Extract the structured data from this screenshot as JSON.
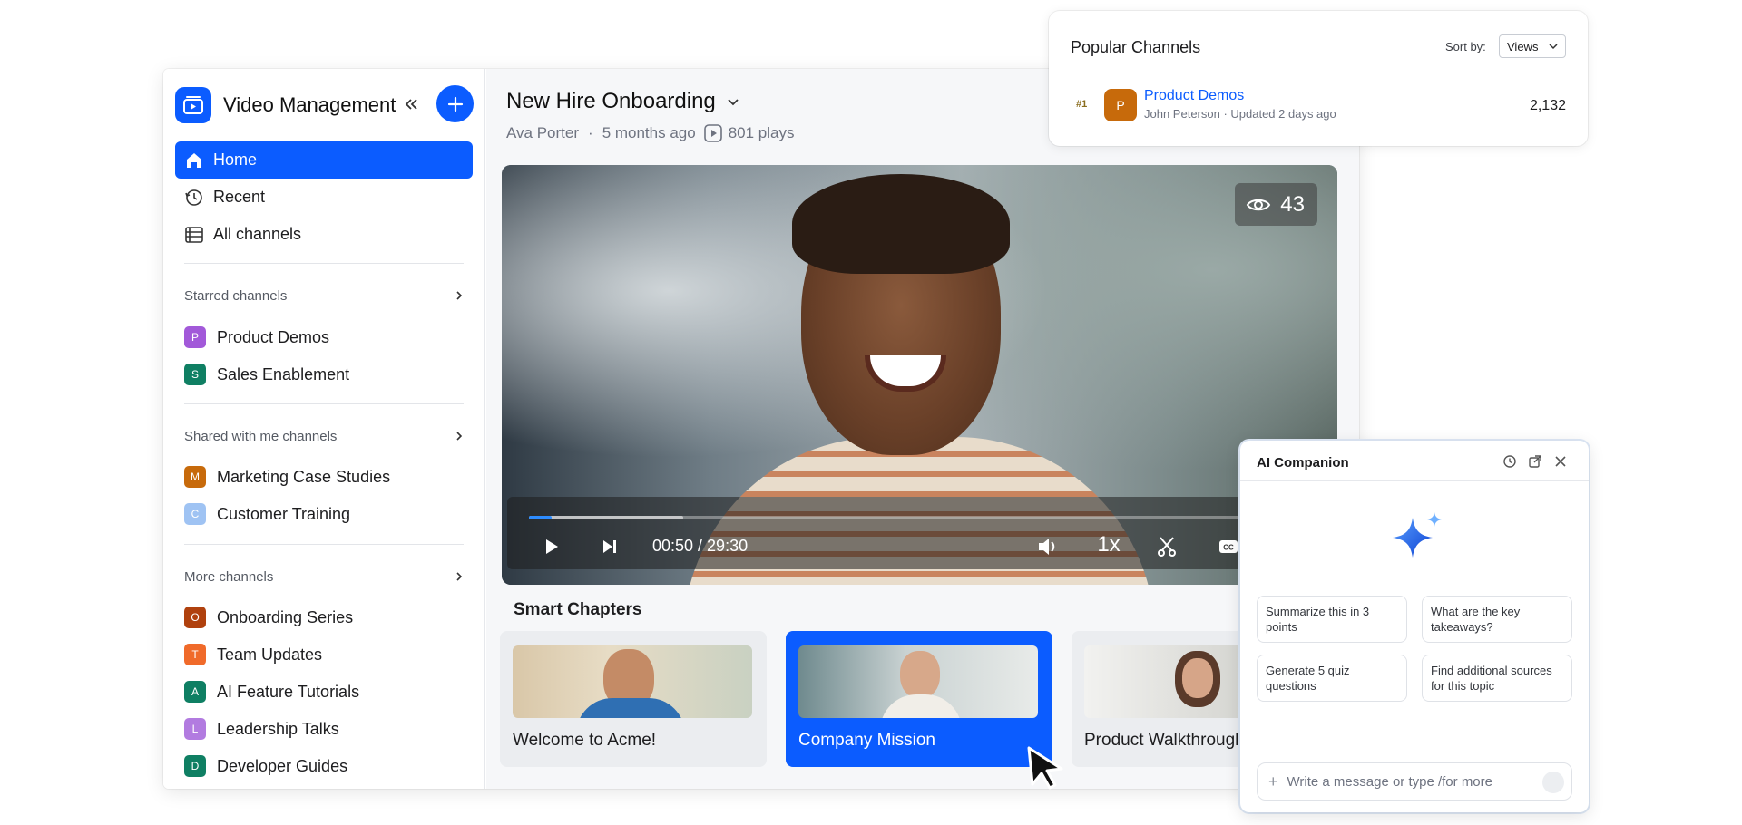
{
  "sidebar": {
    "app_title": "Video Management",
    "nav": [
      {
        "label": "Home",
        "icon": "home-icon",
        "active": true
      },
      {
        "label": "Recent",
        "icon": "history-icon",
        "active": false
      },
      {
        "label": "All channels",
        "icon": "channels-list-icon",
        "active": false
      }
    ],
    "sections": [
      {
        "title": "Starred channels",
        "channels": [
          {
            "letter": "P",
            "name": "Product Demos",
            "color": "#a259d9"
          },
          {
            "letter": "S",
            "name": "Sales Enablement",
            "color": "#0f7f63"
          }
        ]
      },
      {
        "title": "Shared with me channels",
        "channels": [
          {
            "letter": "M",
            "name": "Marketing Case Studies",
            "color": "#c76a0b"
          },
          {
            "letter": "C",
            "name": "Customer Training",
            "color": "#9fc3f3"
          }
        ]
      },
      {
        "title": "More channels",
        "channels": [
          {
            "letter": "O",
            "name": "Onboarding Series",
            "color": "#b0410e"
          },
          {
            "letter": "T",
            "name": "Team Updates",
            "color": "#f06a2a"
          },
          {
            "letter": "A",
            "name": "AI Feature Tutorials",
            "color": "#0f7f63"
          },
          {
            "letter": "L",
            "name": "Leadership Talks",
            "color": "#b27be0"
          },
          {
            "letter": "D",
            "name": "Developer Guides",
            "color": "#0f7f63"
          }
        ]
      }
    ]
  },
  "video": {
    "title": "New Hire Onboarding",
    "author": "Ava Porter",
    "age": "5 months ago",
    "plays": "801 plays",
    "views": "43",
    "time": "00:50 / 29:30",
    "speed": "1x",
    "progress": 0.028
  },
  "chapters": {
    "title": "Smart Chapters",
    "items": [
      {
        "label": "Welcome to Acme!",
        "active": false
      },
      {
        "label": "Company Mission",
        "active": true
      },
      {
        "label": "Product Walkthrough",
        "active": false
      }
    ]
  },
  "popular": {
    "title": "Popular Channels",
    "sort_label": "Sort by:",
    "sort_value": "Views",
    "rank": "#1",
    "badge_letter": "P",
    "channel": "Product Demos",
    "sub": "John Peterson · Updated 2 days ago",
    "count": "2,132"
  },
  "ai": {
    "title": "AI Companion",
    "prompts": [
      "Summarize this in 3 points",
      "What are the key takeaways?",
      "Generate 5 quiz questions",
      "Find additional sources for this topic"
    ],
    "input_placeholder": "Write a message or type /for more"
  },
  "colors": {
    "accent": "#0b5cff"
  }
}
